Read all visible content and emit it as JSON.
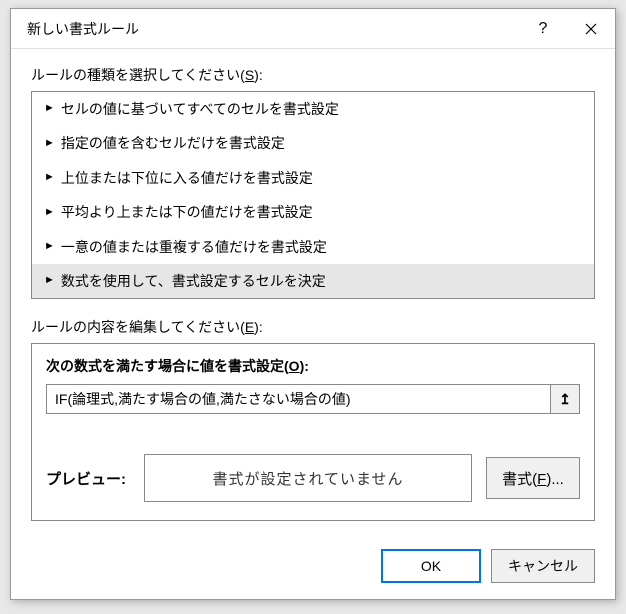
{
  "titlebar": {
    "title": "新しい書式ルール"
  },
  "labels": {
    "select_rule_type_pre": "ルールの種類を選択してください(",
    "select_rule_type_key": "S",
    "select_rule_type_post": "):",
    "edit_rule_desc_pre": "ルールの内容を編集してください(",
    "edit_rule_desc_key": "E",
    "edit_rule_desc_post": "):",
    "formula_label_pre": "次の数式を満たす場合に値を書式設定(",
    "formula_label_key": "O",
    "formula_label_post": "):",
    "preview": "プレビュー:",
    "preview_text": "書式が設定されていません",
    "format_btn_pre": "書式(",
    "format_btn_key": "F",
    "format_btn_post": ")...",
    "ok": "OK",
    "cancel": "キャンセル"
  },
  "rule_types": [
    "セルの値に基づいてすべてのセルを書式設定",
    "指定の値を含むセルだけを書式設定",
    "上位または下位に入る値だけを書式設定",
    "平均より上または下の値だけを書式設定",
    "一意の値または重複する値だけを書式設定",
    "数式を使用して、書式設定するセルを決定"
  ],
  "selected_rule_index": 5,
  "formula": {
    "value": "IF(論理式,満たす場合の値,満たさない場合の値)"
  },
  "icons": {
    "ref": "↥"
  }
}
